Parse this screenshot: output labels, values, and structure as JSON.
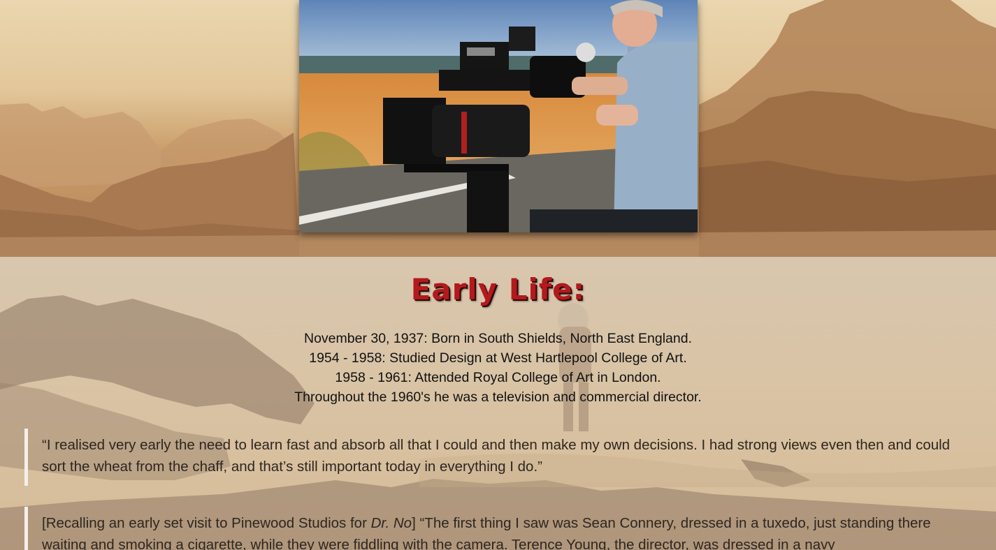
{
  "section": {
    "heading": "Early Life:",
    "timeline": [
      "November 30, 1937: Born in South Shields, North East England.",
      "1954 - 1958: Studied Design at West Hartlepool College of Art.",
      "1958 - 1961: Attended Royal College of Art in London.",
      "Throughout the 1960's he was a television and commercial director."
    ],
    "quotes": [
      {
        "text": "“I realised very early the need to learn fast and absorb all that I could and then make my own decisions. I had strong views even then and could sort the wheat from the chaff, and that’s still important today in everything I do.”"
      },
      {
        "prefix": "[Recalling an early set visit to Pinewood Studios for ",
        "film": "Dr. No",
        "text": "] “The first thing I saw was Sean Connery, dressed in a tuxedo, just standing there waiting and smoking a cigarette, while they were fiddling with the camera. Terence Young, the director, was dressed in a navy"
      }
    ]
  },
  "colors": {
    "heading": "#b3191d",
    "quote_border": "#f4efe9",
    "body_text": "#111111"
  }
}
